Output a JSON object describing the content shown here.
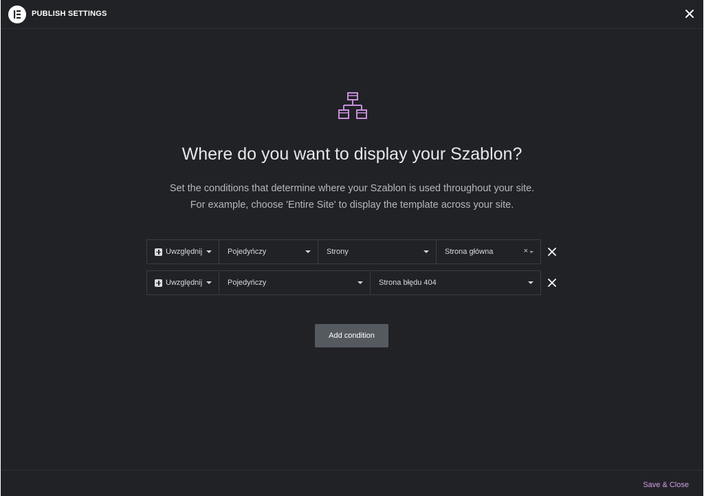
{
  "header": {
    "title": "PUBLISH SETTINGS",
    "logo_icon": "elementor-logo-icon",
    "close_icon": "close-icon"
  },
  "main": {
    "icon": "sitemap-icon",
    "icon_color": "#c78fdc",
    "title": "Where do you want to display your Szablon?",
    "description_line1": "Set the conditions that determine where your Szablon is used throughout your site.",
    "description_line2": "For example, choose 'Entire Site' to display the template across your site."
  },
  "conditions": [
    {
      "type": "Uwzględnij",
      "name": "Pojedyńczy",
      "sub_name": "Strony",
      "sub_id": "Strona główna",
      "sub_id_clear": "×"
    },
    {
      "type": "Uwzględnij",
      "name": "Pojedyńczy",
      "sub_name": "Strona błędu 404"
    }
  ],
  "actions": {
    "add_condition": "Add condition",
    "save_close": "Save & Close"
  },
  "colors": {
    "background": "#212226",
    "accent": "#d49ee6",
    "button": "#555a61"
  }
}
